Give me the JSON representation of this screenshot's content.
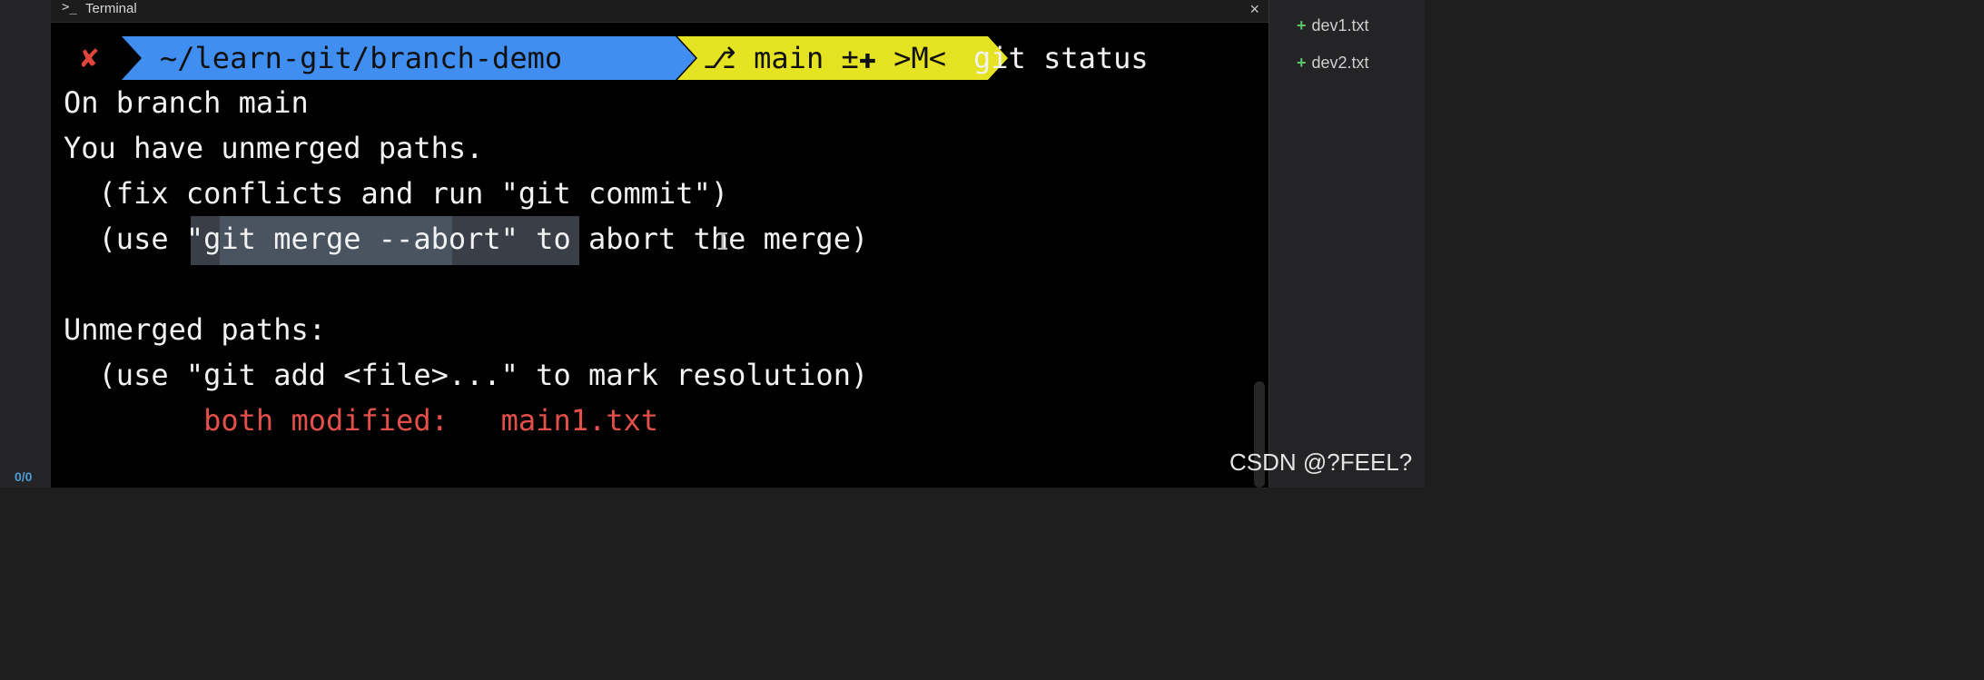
{
  "gutter": {
    "count": "0/0"
  },
  "tab": {
    "icon": ">_",
    "title": "Terminal",
    "close": "×"
  },
  "prompt": {
    "status_icon": "✘",
    "path": "~/learn-git/branch-demo",
    "branch_icon": "⎇",
    "branch": "main ±✚ >M<",
    "command": "git status"
  },
  "output": {
    "line1": "On branch main",
    "line2": "You have unmerged paths.",
    "line3": "  (fix conflicts and run \"git commit\")",
    "line4": "  (use \"git merge --abort\" to abort the merge)",
    "line6": "Unmerged paths:",
    "line7": "  (use \"git add <file>...\" to mark resolution)",
    "line8": "        both modified:   main1.txt"
  },
  "files": [
    {
      "label": "dev1.txt",
      "status": "+"
    },
    {
      "label": "dev2.txt",
      "status": "+"
    }
  ],
  "watermark": "CSDN @?FEEL?",
  "colors": {
    "path_segment": "#3f8ef0",
    "branch_segment": "#e6e322",
    "error_x": "#e0453c",
    "conflict_text": "#e3504a",
    "added": "#5cc46b"
  }
}
